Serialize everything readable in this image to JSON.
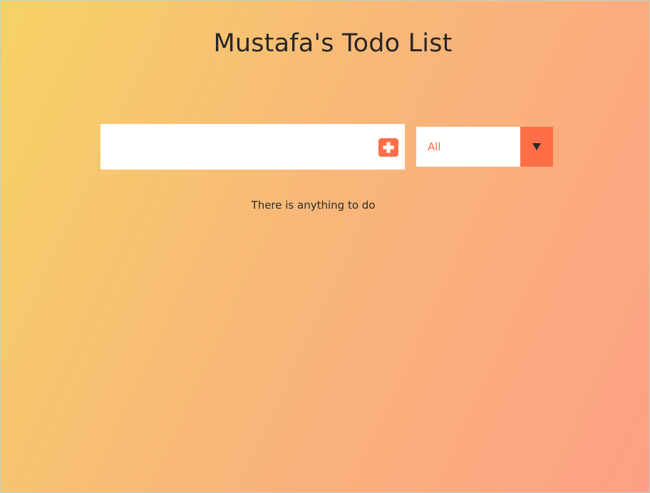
{
  "header": {
    "title": "Mustafa's Todo List"
  },
  "todo_form": {
    "input_value": "",
    "input_placeholder": "",
    "add_icon": "plus-square-icon"
  },
  "filter": {
    "selected": "All",
    "arrow_icon": "caret-down-icon"
  },
  "todo_list": {
    "items": [],
    "empty_message": "There is anything to do"
  },
  "colors": {
    "accent": "#ff6f47",
    "background_start": "#f6d365",
    "background_end": "#fda085"
  }
}
